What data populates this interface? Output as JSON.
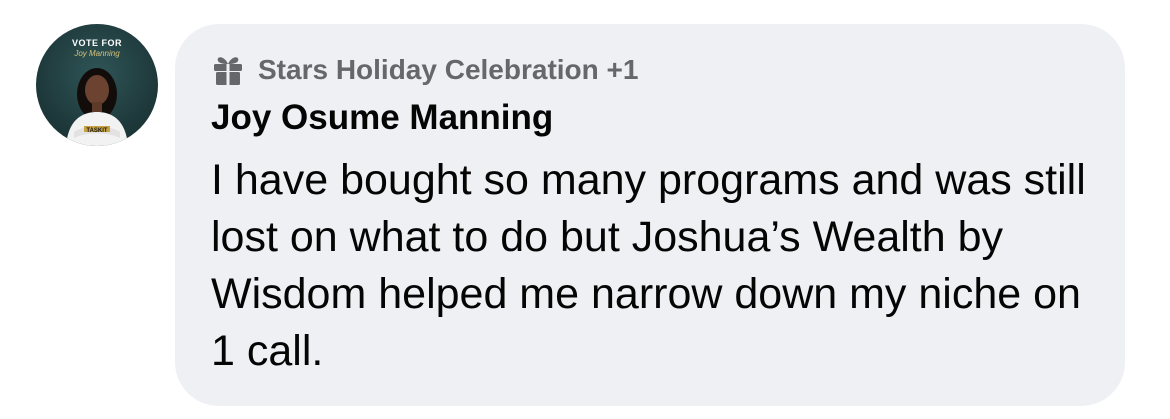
{
  "avatar": {
    "line1": "VOTE FOR",
    "line2": "Joy Manning",
    "footer": "TASKIT"
  },
  "comment": {
    "badge_icon": "gift-icon",
    "badge_text": "Stars Holiday Celebration +1",
    "author": "Joy Osume Manning",
    "text": "I have bought so many programs and was still lost on what to do but Joshua’s Wealth by Wisdom helped me narrow down my niche on 1 call."
  },
  "colors": {
    "bubble_background": "#eff0f4",
    "badge_text": "#65676b",
    "text_primary": "#050505"
  }
}
